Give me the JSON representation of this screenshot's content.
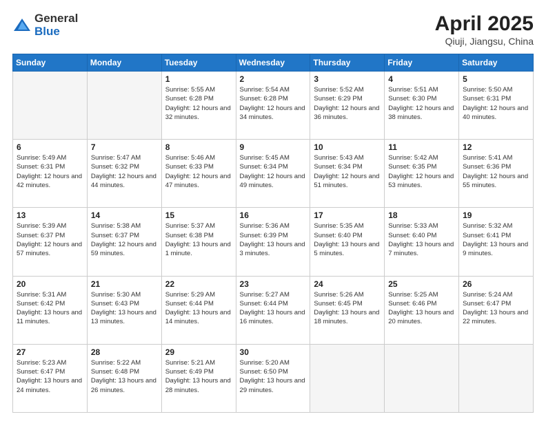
{
  "header": {
    "logo_general": "General",
    "logo_blue": "Blue",
    "title": "April 2025",
    "location": "Qiuji, Jiangsu, China"
  },
  "days_of_week": [
    "Sunday",
    "Monday",
    "Tuesday",
    "Wednesday",
    "Thursday",
    "Friday",
    "Saturday"
  ],
  "weeks": [
    [
      {
        "day": "",
        "info": ""
      },
      {
        "day": "",
        "info": ""
      },
      {
        "day": "1",
        "info": "Sunrise: 5:55 AM\nSunset: 6:28 PM\nDaylight: 12 hours\nand 32 minutes."
      },
      {
        "day": "2",
        "info": "Sunrise: 5:54 AM\nSunset: 6:28 PM\nDaylight: 12 hours\nand 34 minutes."
      },
      {
        "day": "3",
        "info": "Sunrise: 5:52 AM\nSunset: 6:29 PM\nDaylight: 12 hours\nand 36 minutes."
      },
      {
        "day": "4",
        "info": "Sunrise: 5:51 AM\nSunset: 6:30 PM\nDaylight: 12 hours\nand 38 minutes."
      },
      {
        "day": "5",
        "info": "Sunrise: 5:50 AM\nSunset: 6:31 PM\nDaylight: 12 hours\nand 40 minutes."
      }
    ],
    [
      {
        "day": "6",
        "info": "Sunrise: 5:49 AM\nSunset: 6:31 PM\nDaylight: 12 hours\nand 42 minutes."
      },
      {
        "day": "7",
        "info": "Sunrise: 5:47 AM\nSunset: 6:32 PM\nDaylight: 12 hours\nand 44 minutes."
      },
      {
        "day": "8",
        "info": "Sunrise: 5:46 AM\nSunset: 6:33 PM\nDaylight: 12 hours\nand 47 minutes."
      },
      {
        "day": "9",
        "info": "Sunrise: 5:45 AM\nSunset: 6:34 PM\nDaylight: 12 hours\nand 49 minutes."
      },
      {
        "day": "10",
        "info": "Sunrise: 5:43 AM\nSunset: 6:34 PM\nDaylight: 12 hours\nand 51 minutes."
      },
      {
        "day": "11",
        "info": "Sunrise: 5:42 AM\nSunset: 6:35 PM\nDaylight: 12 hours\nand 53 minutes."
      },
      {
        "day": "12",
        "info": "Sunrise: 5:41 AM\nSunset: 6:36 PM\nDaylight: 12 hours\nand 55 minutes."
      }
    ],
    [
      {
        "day": "13",
        "info": "Sunrise: 5:39 AM\nSunset: 6:37 PM\nDaylight: 12 hours\nand 57 minutes."
      },
      {
        "day": "14",
        "info": "Sunrise: 5:38 AM\nSunset: 6:37 PM\nDaylight: 12 hours\nand 59 minutes."
      },
      {
        "day": "15",
        "info": "Sunrise: 5:37 AM\nSunset: 6:38 PM\nDaylight: 13 hours\nand 1 minute."
      },
      {
        "day": "16",
        "info": "Sunrise: 5:36 AM\nSunset: 6:39 PM\nDaylight: 13 hours\nand 3 minutes."
      },
      {
        "day": "17",
        "info": "Sunrise: 5:35 AM\nSunset: 6:40 PM\nDaylight: 13 hours\nand 5 minutes."
      },
      {
        "day": "18",
        "info": "Sunrise: 5:33 AM\nSunset: 6:40 PM\nDaylight: 13 hours\nand 7 minutes."
      },
      {
        "day": "19",
        "info": "Sunrise: 5:32 AM\nSunset: 6:41 PM\nDaylight: 13 hours\nand 9 minutes."
      }
    ],
    [
      {
        "day": "20",
        "info": "Sunrise: 5:31 AM\nSunset: 6:42 PM\nDaylight: 13 hours\nand 11 minutes."
      },
      {
        "day": "21",
        "info": "Sunrise: 5:30 AM\nSunset: 6:43 PM\nDaylight: 13 hours\nand 13 minutes."
      },
      {
        "day": "22",
        "info": "Sunrise: 5:29 AM\nSunset: 6:44 PM\nDaylight: 13 hours\nand 14 minutes."
      },
      {
        "day": "23",
        "info": "Sunrise: 5:27 AM\nSunset: 6:44 PM\nDaylight: 13 hours\nand 16 minutes."
      },
      {
        "day": "24",
        "info": "Sunrise: 5:26 AM\nSunset: 6:45 PM\nDaylight: 13 hours\nand 18 minutes."
      },
      {
        "day": "25",
        "info": "Sunrise: 5:25 AM\nSunset: 6:46 PM\nDaylight: 13 hours\nand 20 minutes."
      },
      {
        "day": "26",
        "info": "Sunrise: 5:24 AM\nSunset: 6:47 PM\nDaylight: 13 hours\nand 22 minutes."
      }
    ],
    [
      {
        "day": "27",
        "info": "Sunrise: 5:23 AM\nSunset: 6:47 PM\nDaylight: 13 hours\nand 24 minutes."
      },
      {
        "day": "28",
        "info": "Sunrise: 5:22 AM\nSunset: 6:48 PM\nDaylight: 13 hours\nand 26 minutes."
      },
      {
        "day": "29",
        "info": "Sunrise: 5:21 AM\nSunset: 6:49 PM\nDaylight: 13 hours\nand 28 minutes."
      },
      {
        "day": "30",
        "info": "Sunrise: 5:20 AM\nSunset: 6:50 PM\nDaylight: 13 hours\nand 29 minutes."
      },
      {
        "day": "",
        "info": ""
      },
      {
        "day": "",
        "info": ""
      },
      {
        "day": "",
        "info": ""
      }
    ]
  ]
}
